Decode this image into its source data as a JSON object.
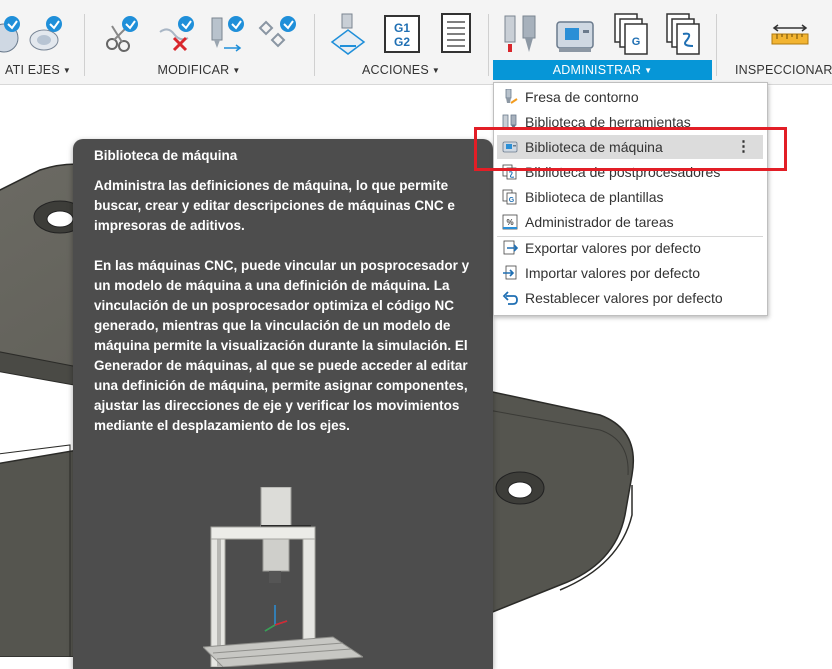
{
  "toolbar": {
    "groups": [
      {
        "label": "ATI EJES",
        "caret": "▼"
      },
      {
        "label": "MODIFICAR",
        "caret": "▼"
      },
      {
        "label": "ACCIONES",
        "caret": "▼"
      },
      {
        "label": "ADMINISTRAR",
        "caret": "▼"
      },
      {
        "label": "INSPECCIONAR",
        "caret": ""
      }
    ],
    "gcode_icon_text": [
      "G1",
      "G2"
    ],
    "accent_color": "#0696d7"
  },
  "menu": {
    "items": [
      {
        "label": "Fresa de contorno",
        "icon": "end-mill-icon"
      },
      {
        "label": "Biblioteca de herramientas",
        "icon": "tool-library-icon"
      },
      {
        "label": "Biblioteca de máquina",
        "icon": "machine-library-icon",
        "more": "⋮"
      },
      {
        "label": "Biblioteca de postprocesadores",
        "icon": "post-library-icon"
      },
      {
        "label": "Biblioteca de plantillas",
        "icon": "template-library-icon"
      },
      {
        "label": "Administrador de tareas",
        "icon": "task-manager-icon"
      },
      {
        "label": "Exportar valores por defecto",
        "icon": "export-icon"
      },
      {
        "label": "Importar valores por defecto",
        "icon": "import-icon"
      },
      {
        "label": "Restablecer valores por defecto",
        "icon": "reset-icon"
      }
    ]
  },
  "tooltip": {
    "title": "Biblioteca de máquina",
    "paragraph1": "Administra las definiciones de máquina, lo que permite buscar, crear y editar descripciones de máquinas CNC e impresoras de aditivos.",
    "paragraph2": "En las máquinas CNC, puede vincular un posprocesador y un modelo de máquina a una definición de máquina. La vinculación de un posprocesador optimiza el código NC generado, mientras que la vinculación de un modelo de máquina permite la visualización durante la simulación. El Generador de máquinas, al que se puede acceder al editar una definición de máquina, permite asignar componentes, ajustar las direcciones de eje y verificar los movimientos mediante el desplazamiento de los ejes."
  },
  "highlight_color": "#e21e26"
}
